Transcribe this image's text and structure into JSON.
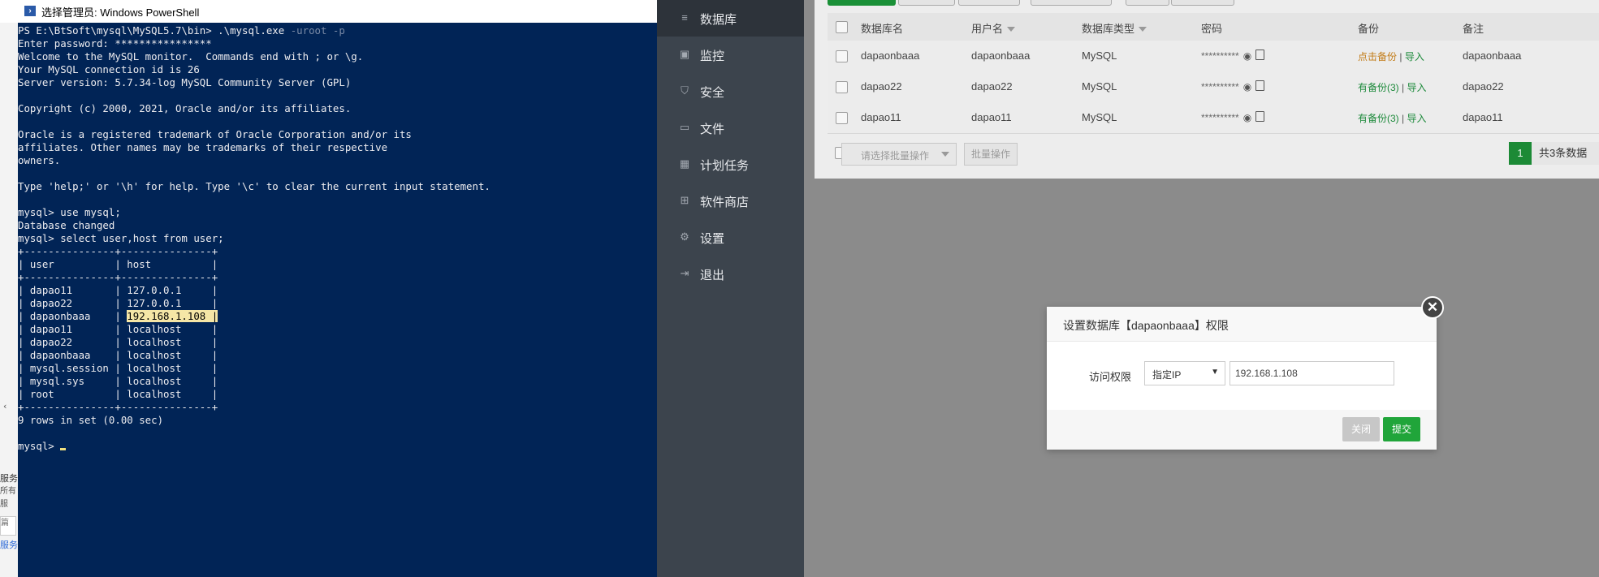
{
  "powershell": {
    "title": "选择管理员: Windows PowerShell",
    "lines": [
      {
        "pre": "PS E:\\BtSoft\\mysql\\MySQL5.7\\bin> .\\mysql.exe ",
        "dim": "-uroot -p"
      },
      {
        "text": "Enter password: ****************"
      },
      {
        "text": "Welcome to the MySQL monitor.  Commands end with ; or \\g."
      },
      {
        "text": "Your MySQL connection id is 26"
      },
      {
        "text": "Server version: 5.7.34-log MySQL Community Server (GPL)"
      },
      {
        "text": ""
      },
      {
        "text": "Copyright (c) 2000, 2021, Oracle and/or its affiliates."
      },
      {
        "text": ""
      },
      {
        "text": "Oracle is a registered trademark of Oracle Corporation and/or its"
      },
      {
        "text": "affiliates. Other names may be trademarks of their respective"
      },
      {
        "text": "owners."
      },
      {
        "text": ""
      },
      {
        "text": "Type 'help;' or '\\h' for help. Type '\\c' to clear the current input statement."
      },
      {
        "text": ""
      },
      {
        "text": "mysql> use mysql;"
      },
      {
        "text": "Database changed"
      },
      {
        "text": "mysql> select user,host from user;"
      },
      {
        "text": "+---------------+---------------+"
      },
      {
        "text": "| user          | host          |"
      },
      {
        "text": "+---------------+---------------+"
      },
      {
        "text": "| dapao11       | 127.0.0.1     |"
      },
      {
        "text": "| dapao22       | 127.0.0.1     |"
      },
      {
        "pre": "| dapaonbaaa    | ",
        "hl": "192.168.1.108 |"
      },
      {
        "text": "| dapao11       | localhost     |"
      },
      {
        "text": "| dapao22       | localhost     |"
      },
      {
        "text": "| dapaonbaaa    | localhost     |"
      },
      {
        "text": "| mysql.session | localhost     |"
      },
      {
        "text": "| mysql.sys     | localhost     |"
      },
      {
        "text": "| root          | localhost     |"
      },
      {
        "text": "+---------------+---------------+"
      },
      {
        "text": "9 rows in set (0.00 sec)"
      },
      {
        "text": ""
      },
      {
        "pre": "mysql> ",
        "cursor": true
      }
    ]
  },
  "left_fragment": {
    "line1": "服务",
    "line2": "所有服",
    "input": "篇",
    "link": "服务"
  },
  "sidebar": {
    "items": [
      {
        "label": "数据库",
        "icon": "database-icon",
        "glyph": "≡",
        "active": true
      },
      {
        "label": "监控",
        "icon": "monitor-icon",
        "glyph": "▣"
      },
      {
        "label": "安全",
        "icon": "shield-icon",
        "glyph": "⛉"
      },
      {
        "label": "文件",
        "icon": "folder-icon",
        "glyph": "▭"
      },
      {
        "label": "计划任务",
        "icon": "calendar-icon",
        "glyph": "▦"
      },
      {
        "label": "软件商店",
        "icon": "grid-icon",
        "glyph": "⊞"
      },
      {
        "label": "设置",
        "icon": "gear-icon",
        "glyph": "⚙"
      },
      {
        "label": "退出",
        "icon": "logout-icon",
        "glyph": "⇥"
      }
    ]
  },
  "table": {
    "headers": {
      "name": "数据库名",
      "user": "用户名",
      "type": "数据库类型",
      "password": "密码",
      "backup": "备份",
      "note": "备注"
    },
    "rows": [
      {
        "name": "dapaonbaaa",
        "user": "dapaonbaaa",
        "type": "MySQL",
        "password": "**********",
        "backup": "点击备份",
        "backup_style": "orange",
        "import": "导入",
        "note": "dapaonbaaa"
      },
      {
        "name": "dapao22",
        "user": "dapao22",
        "type": "MySQL",
        "password": "**********",
        "backup": "有备份(3)",
        "backup_style": "green",
        "import": "导入",
        "note": "dapao22"
      },
      {
        "name": "dapao11",
        "user": "dapao11",
        "type": "MySQL",
        "password": "**********",
        "backup": "有备份(3)",
        "backup_style": "green",
        "import": "导入",
        "note": "dapao11"
      }
    ],
    "separator": "|",
    "batch_placeholder": "请选择批量操作",
    "batch_button": "批量操作",
    "page_current": "1",
    "page_total": "共3条数据"
  },
  "dialog": {
    "title": "设置数据库【dapaonbaaa】权限",
    "access_label": "访问权限",
    "access_value": "指定IP",
    "ip_value": "192.168.1.108",
    "close_label": "关闭",
    "submit_label": "提交",
    "close_icon": "✕"
  },
  "colors": {
    "console_bg": "#012456",
    "sidebar_bg": "#3c444d",
    "accent_green": "#20a53a",
    "backup_orange": "#c27b16"
  }
}
